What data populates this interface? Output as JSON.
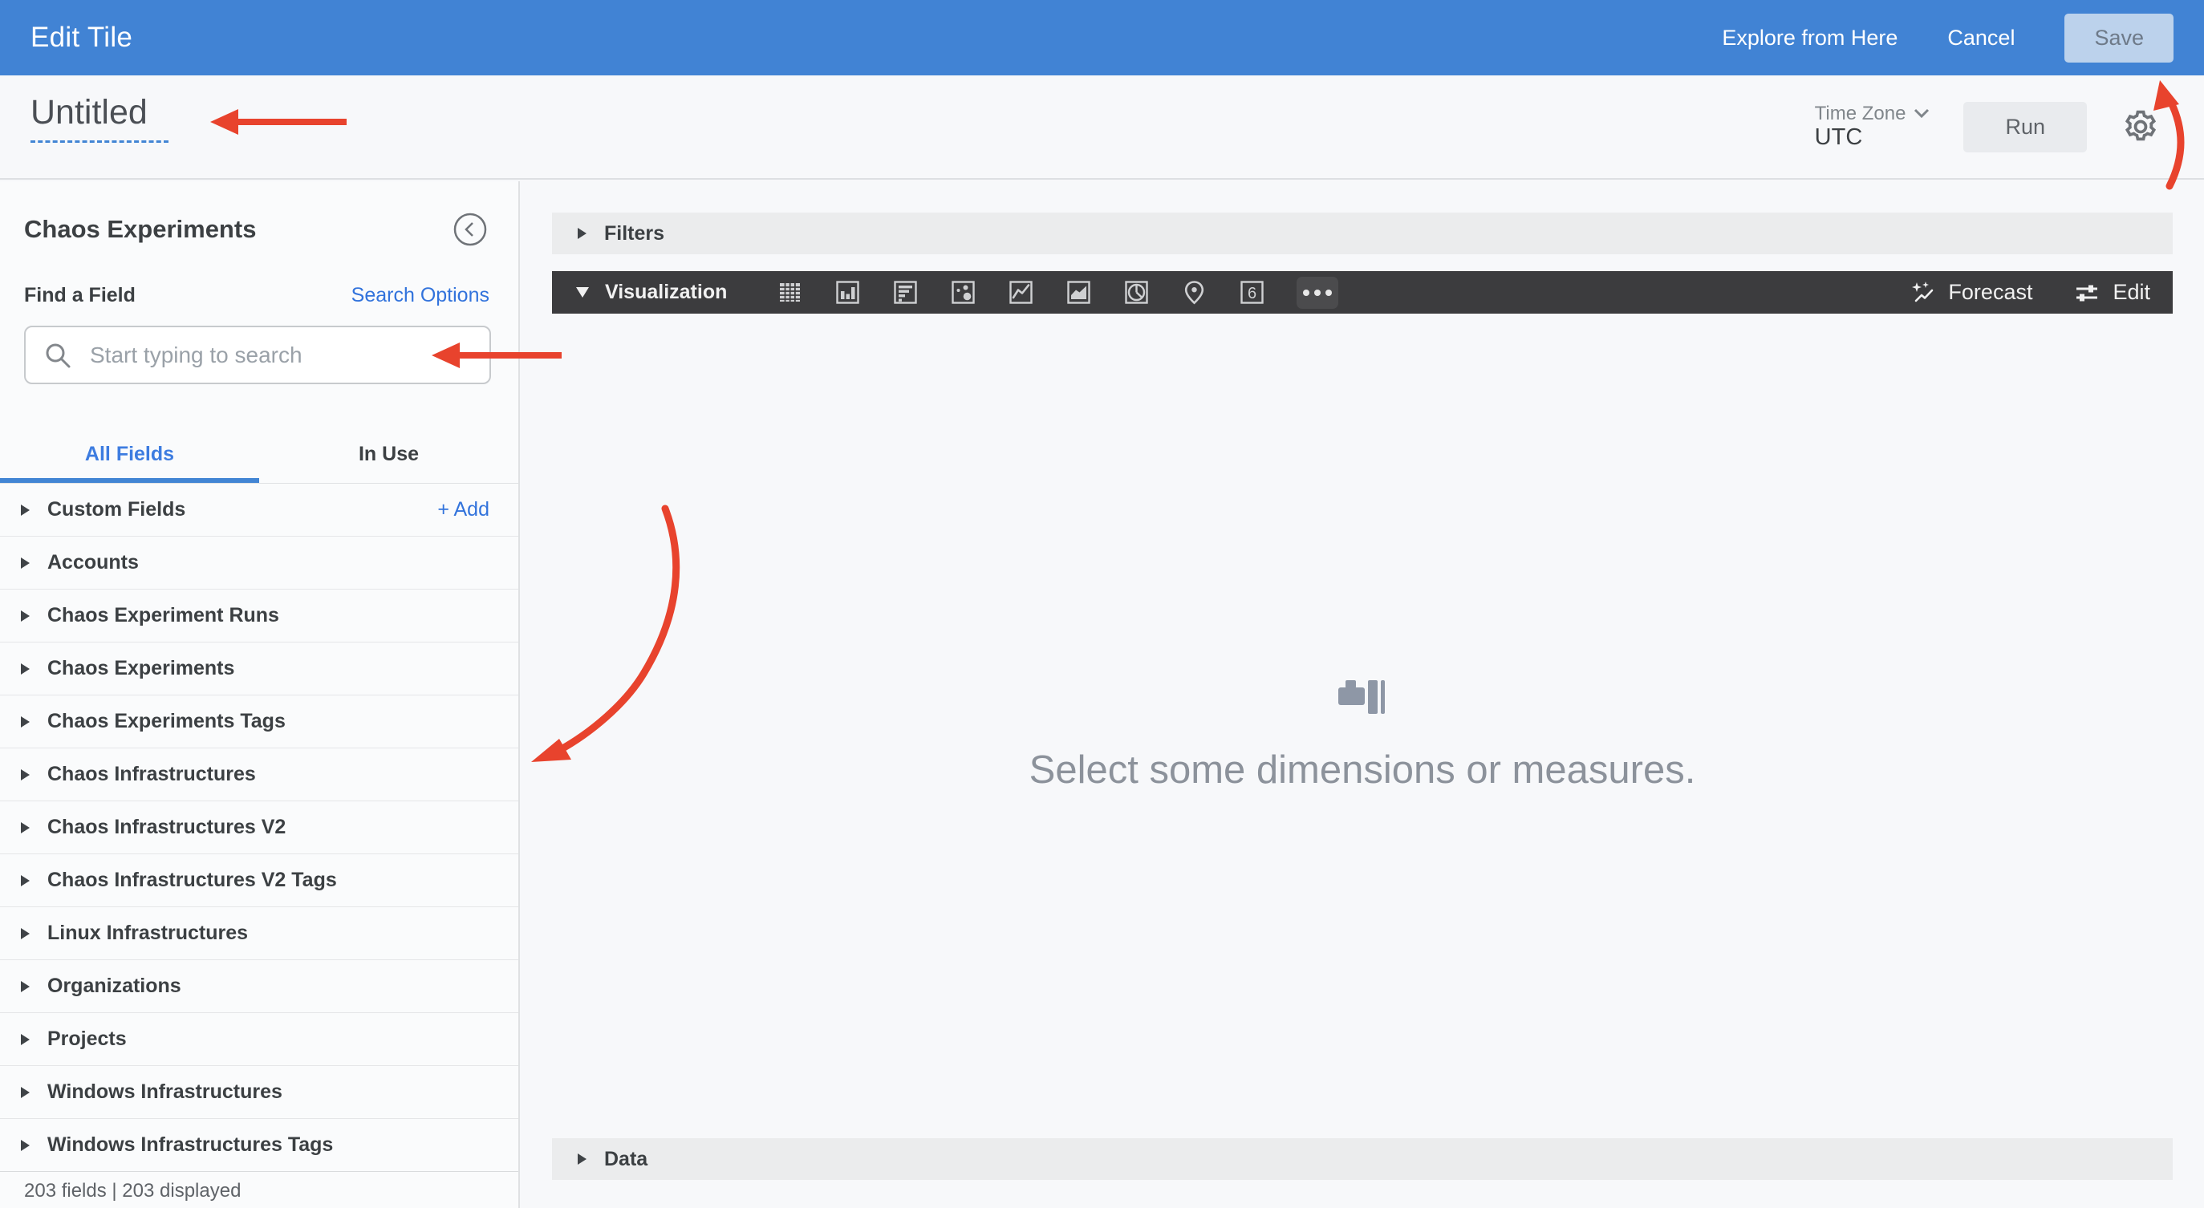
{
  "app_header": {
    "title": "Edit Tile",
    "explore_from_here": "Explore from Here",
    "cancel": "Cancel",
    "save": "Save"
  },
  "toolbar": {
    "tile_title": "Untitled",
    "timezone_label": "Time Zone",
    "timezone_value": "UTC",
    "run": "Run"
  },
  "sidebar": {
    "title": "Chaos Experiments",
    "find_a_field": "Find a Field",
    "search_options": "Search Options",
    "search_placeholder": "Start typing to search",
    "tabs": {
      "all_fields": "All Fields",
      "in_use": "In Use"
    },
    "custom_fields": {
      "label": "Custom Fields",
      "add": "+ Add"
    },
    "field_groups": [
      "Accounts",
      "Chaos Experiment Runs",
      "Chaos Experiments",
      "Chaos Experiments Tags",
      "Chaos Infrastructures",
      "Chaos Infrastructures V2",
      "Chaos Infrastructures V2 Tags",
      "Linux Infrastructures",
      "Organizations",
      "Projects",
      "Windows Infrastructures",
      "Windows Infrastructures Tags"
    ],
    "footer": "203 fields | 203 displayed"
  },
  "main": {
    "filters": "Filters",
    "visualization": "Visualization",
    "viz_types": [
      "table",
      "column",
      "bar",
      "scatter",
      "line",
      "area",
      "pie",
      "map",
      "single-value",
      "more"
    ],
    "single_value_glyph": "6",
    "forecast": "Forecast",
    "edit": "Edit",
    "empty_message": "Select some dimensions or measures.",
    "data": "Data"
  },
  "colors": {
    "header_blue": "#4183d4",
    "accent_blue": "#3273dc",
    "tab_active_blue": "#3d7ce0",
    "viz_bar_dark": "#3c3c3e",
    "annotation_red": "#e8432d",
    "save_button_bg": "#bcd2ec"
  }
}
